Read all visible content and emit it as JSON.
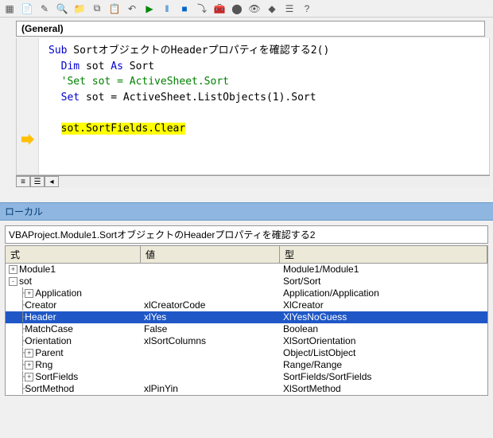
{
  "toolbar": {
    "icons": [
      "excel-icon",
      "word-icon",
      "separator",
      "insert-icon",
      "find-icon",
      "folder-icon",
      "copy-icon",
      "paste-icon",
      "undo-icon",
      "play-icon",
      "pause-icon",
      "stop-icon",
      "step-icon",
      "toolbox-icon",
      "breakpoint-icon",
      "bookmark-icon",
      "watch-icon",
      "properties-icon",
      "help-icon"
    ]
  },
  "dropdown": {
    "general": "(General)"
  },
  "code": {
    "sub_kw": "Sub",
    "sub_name": " SortオブジェクトのHeaderプロパティを確認する2()",
    "dim_kw": "Dim",
    "dim_rest1": " sot ",
    "as_kw": "As",
    "dim_rest2": " Sort",
    "comment": "'Set sot = ActiveSheet.Sort",
    "set_kw": "Set",
    "set_rest": " sot = ActiveSheet.ListObjects(1).Sort",
    "highlighted": "sot.SortFields.Clear"
  },
  "locals": {
    "title": "ローカル",
    "context": "VBAProject.Module1.SortオブジェクトのHeaderプロパティを確認する2",
    "headers": {
      "expr": "式",
      "val": "値",
      "type": "型"
    },
    "rows": [
      {
        "indent": 0,
        "toggle": "+",
        "name": "Module1",
        "val": "",
        "type": "Module1/Module1",
        "selected": false
      },
      {
        "indent": 0,
        "toggle": "-",
        "name": "sot",
        "val": "",
        "type": "Sort/Sort",
        "selected": false
      },
      {
        "indent": 1,
        "toggle": "+",
        "name": "Application",
        "val": "",
        "type": "Application/Application",
        "selected": false
      },
      {
        "indent": 1,
        "toggle": "",
        "name": "Creator",
        "val": "xlCreatorCode",
        "type": "XlCreator",
        "selected": false
      },
      {
        "indent": 1,
        "toggle": "",
        "name": "Header",
        "val": "xlYes",
        "type": "XlYesNoGuess",
        "selected": true
      },
      {
        "indent": 1,
        "toggle": "",
        "name": "MatchCase",
        "val": "False",
        "type": "Boolean",
        "selected": false
      },
      {
        "indent": 1,
        "toggle": "",
        "name": "Orientation",
        "val": "xlSortColumns",
        "type": "XlSortOrientation",
        "selected": false
      },
      {
        "indent": 1,
        "toggle": "+",
        "name": "Parent",
        "val": "",
        "type": "Object/ListObject",
        "selected": false
      },
      {
        "indent": 1,
        "toggle": "+",
        "name": "Rng",
        "val": "",
        "type": "Range/Range",
        "selected": false
      },
      {
        "indent": 1,
        "toggle": "+",
        "name": "SortFields",
        "val": "",
        "type": "SortFields/SortFields",
        "selected": false
      },
      {
        "indent": 1,
        "toggle": "",
        "name": "SortMethod",
        "val": "xlPinYin",
        "type": "XlSortMethod",
        "selected": false
      }
    ]
  }
}
